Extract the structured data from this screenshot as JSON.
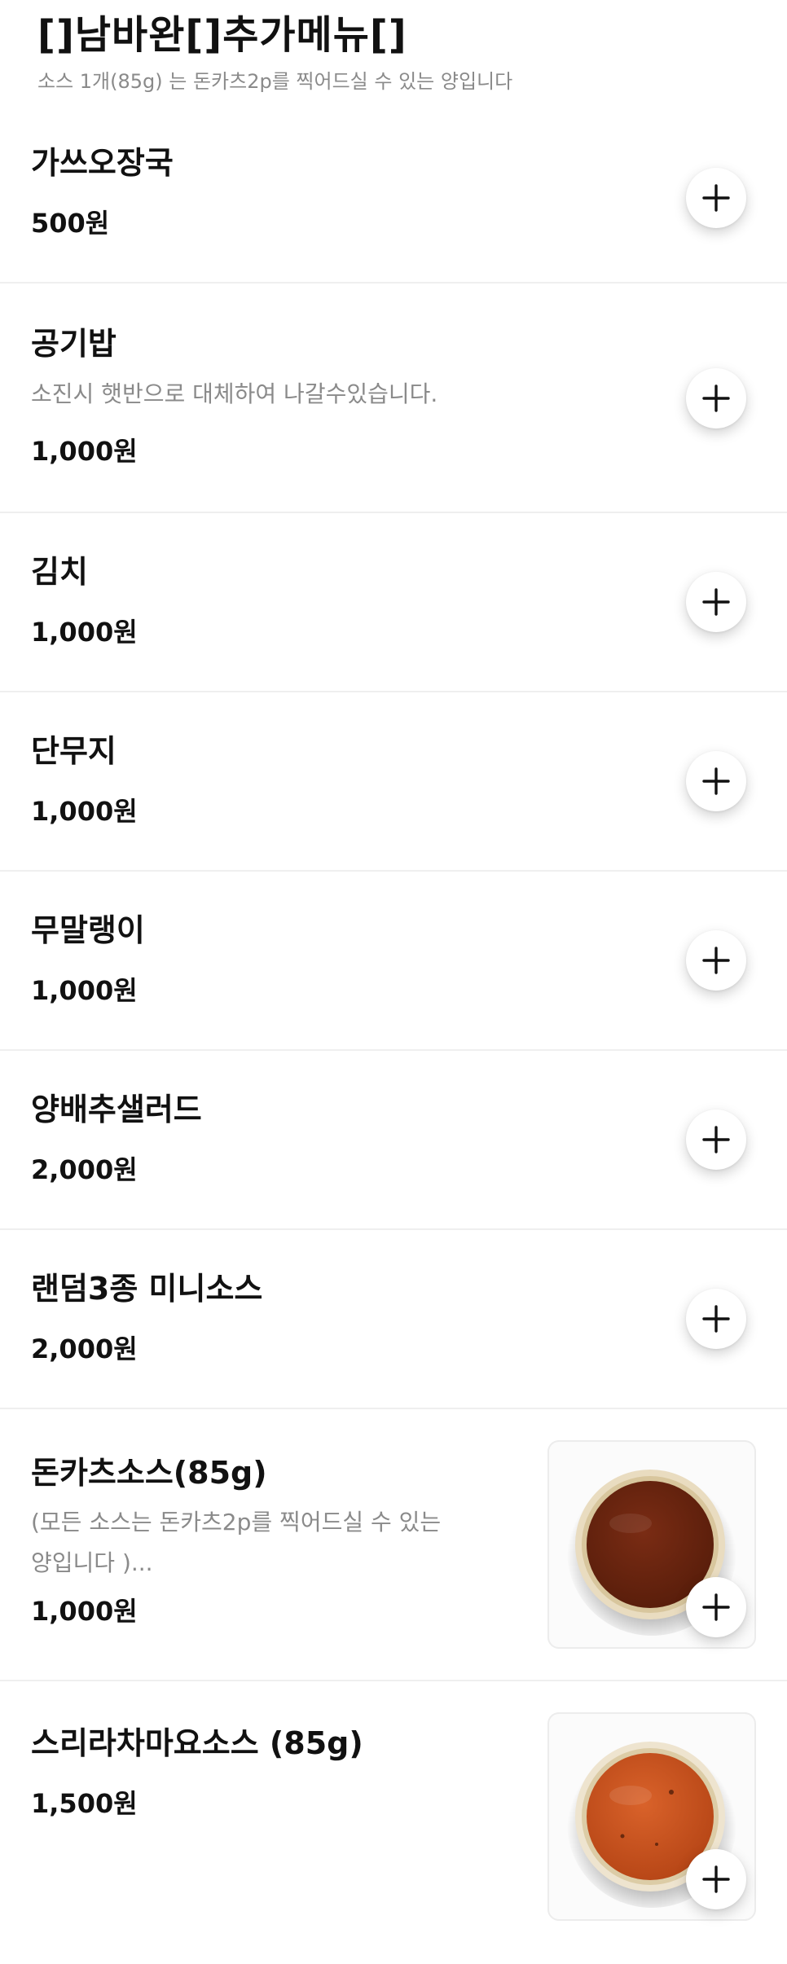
{
  "section": {
    "title": "[]남바완[]추가메뉴[]",
    "description": "소스 1개(85g) 는 돈카츠2p를 찍어드실 수 있는 양입니다"
  },
  "items": [
    {
      "name": "가쓰오장국",
      "price": "500원"
    },
    {
      "name": "공기밥",
      "description": "소진시 햇반으로 대체하여 나갈수있습니다.",
      "price": "1,000원"
    },
    {
      "name": "김치",
      "price": "1,000원"
    },
    {
      "name": "단무지",
      "price": "1,000원"
    },
    {
      "name": "무말랭이",
      "price": "1,000원"
    },
    {
      "name": "양배추샐러드",
      "price": "2,000원"
    },
    {
      "name": "랜덤3종 미니소스",
      "price": "2,000원"
    },
    {
      "name": "돈카츠소스(85g)",
      "description_line1": "(모든 소스는 돈카츠2p를 찍어드실 수 있는",
      "description_line2": "양입니다 )...",
      "price": "1,000원",
      "image_color": "#6b2410"
    },
    {
      "name": "스리라차마요소스 (85g)",
      "price": "1,500원",
      "image_color": "#c7541d"
    }
  ],
  "icons": {
    "add": "plus-icon"
  }
}
